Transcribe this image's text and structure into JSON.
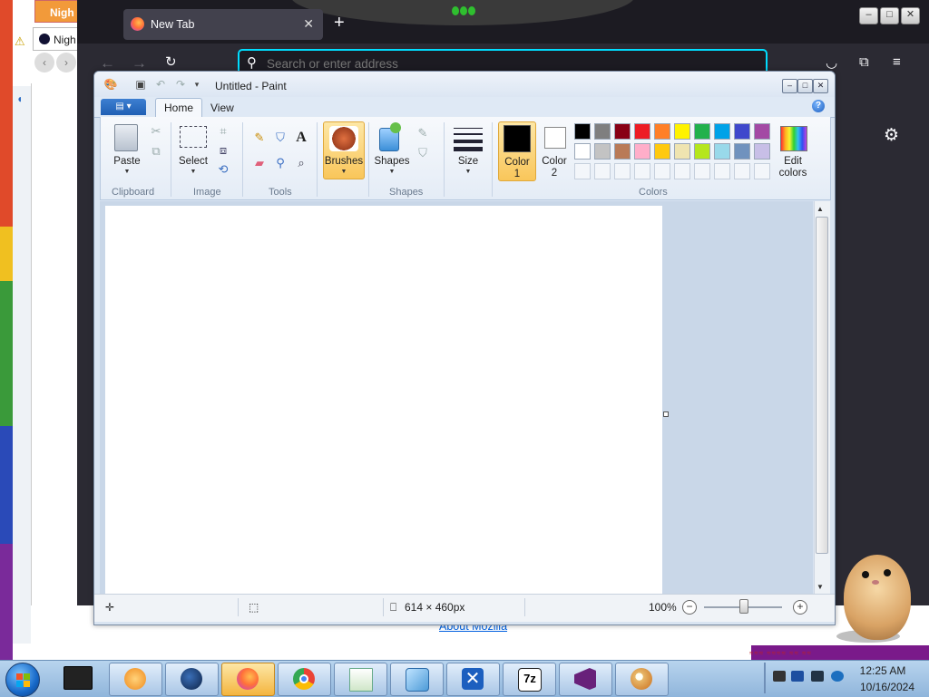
{
  "background": {
    "old_browser": {
      "tab1_label": "Nigh",
      "tab2_label": "Nigh"
    },
    "firefox": {
      "tab_title": "New Tab",
      "tab_close": "✕",
      "new_tab": "+",
      "url_placeholder": "Search or enter address",
      "about_link": "About Mozilla"
    }
  },
  "paint": {
    "window_title": "Untitled - Paint",
    "tabs": {
      "home": "Home",
      "view": "View"
    },
    "groups": {
      "clipboard": "Clipboard",
      "image": "Image",
      "tools": "Tools",
      "shapes": "Shapes",
      "colors": "Colors"
    },
    "buttons": {
      "paste": "Paste",
      "select": "Select",
      "brushes": "Brushes",
      "shapes": "Shapes",
      "size": "Size",
      "color1_line1": "Color",
      "color1_line2": "1",
      "color2_line1": "Color",
      "color2_line2": "2",
      "edit_colors_line1": "Edit",
      "edit_colors_line2": "colors"
    },
    "color1": "#000000",
    "color2": "#ffffff",
    "palette_row1": [
      "#000000",
      "#7f7f7f",
      "#880015",
      "#ed1c24",
      "#ff7f27",
      "#fff200",
      "#22b14c",
      "#00a2e8",
      "#3f48cc",
      "#a349a4"
    ],
    "palette_row2": [
      "#ffffff",
      "#c3c3c3",
      "#b97a57",
      "#ffaec9",
      "#ffc90e",
      "#efe4b0",
      "#b5e61d",
      "#99d9ea",
      "#7092be",
      "#c8bfe7"
    ],
    "palette_row3": [
      "",
      "",
      "",
      "",
      "",
      "",
      "",
      "",
      "",
      ""
    ],
    "status": {
      "image_size": "614 × 460px",
      "zoom": "100%"
    }
  },
  "taskbar": {
    "time": "12:25 AM",
    "date": "10/16/2024",
    "apps": [
      "windows-media-icon",
      "globe-icon",
      "firefox-icon",
      "chrome-icon",
      "notepad-icon",
      "file-icon",
      "x-icon",
      "7zip-icon",
      "visual-studio-icon",
      "paint-icon"
    ],
    "sevenzip_label": "7z"
  }
}
